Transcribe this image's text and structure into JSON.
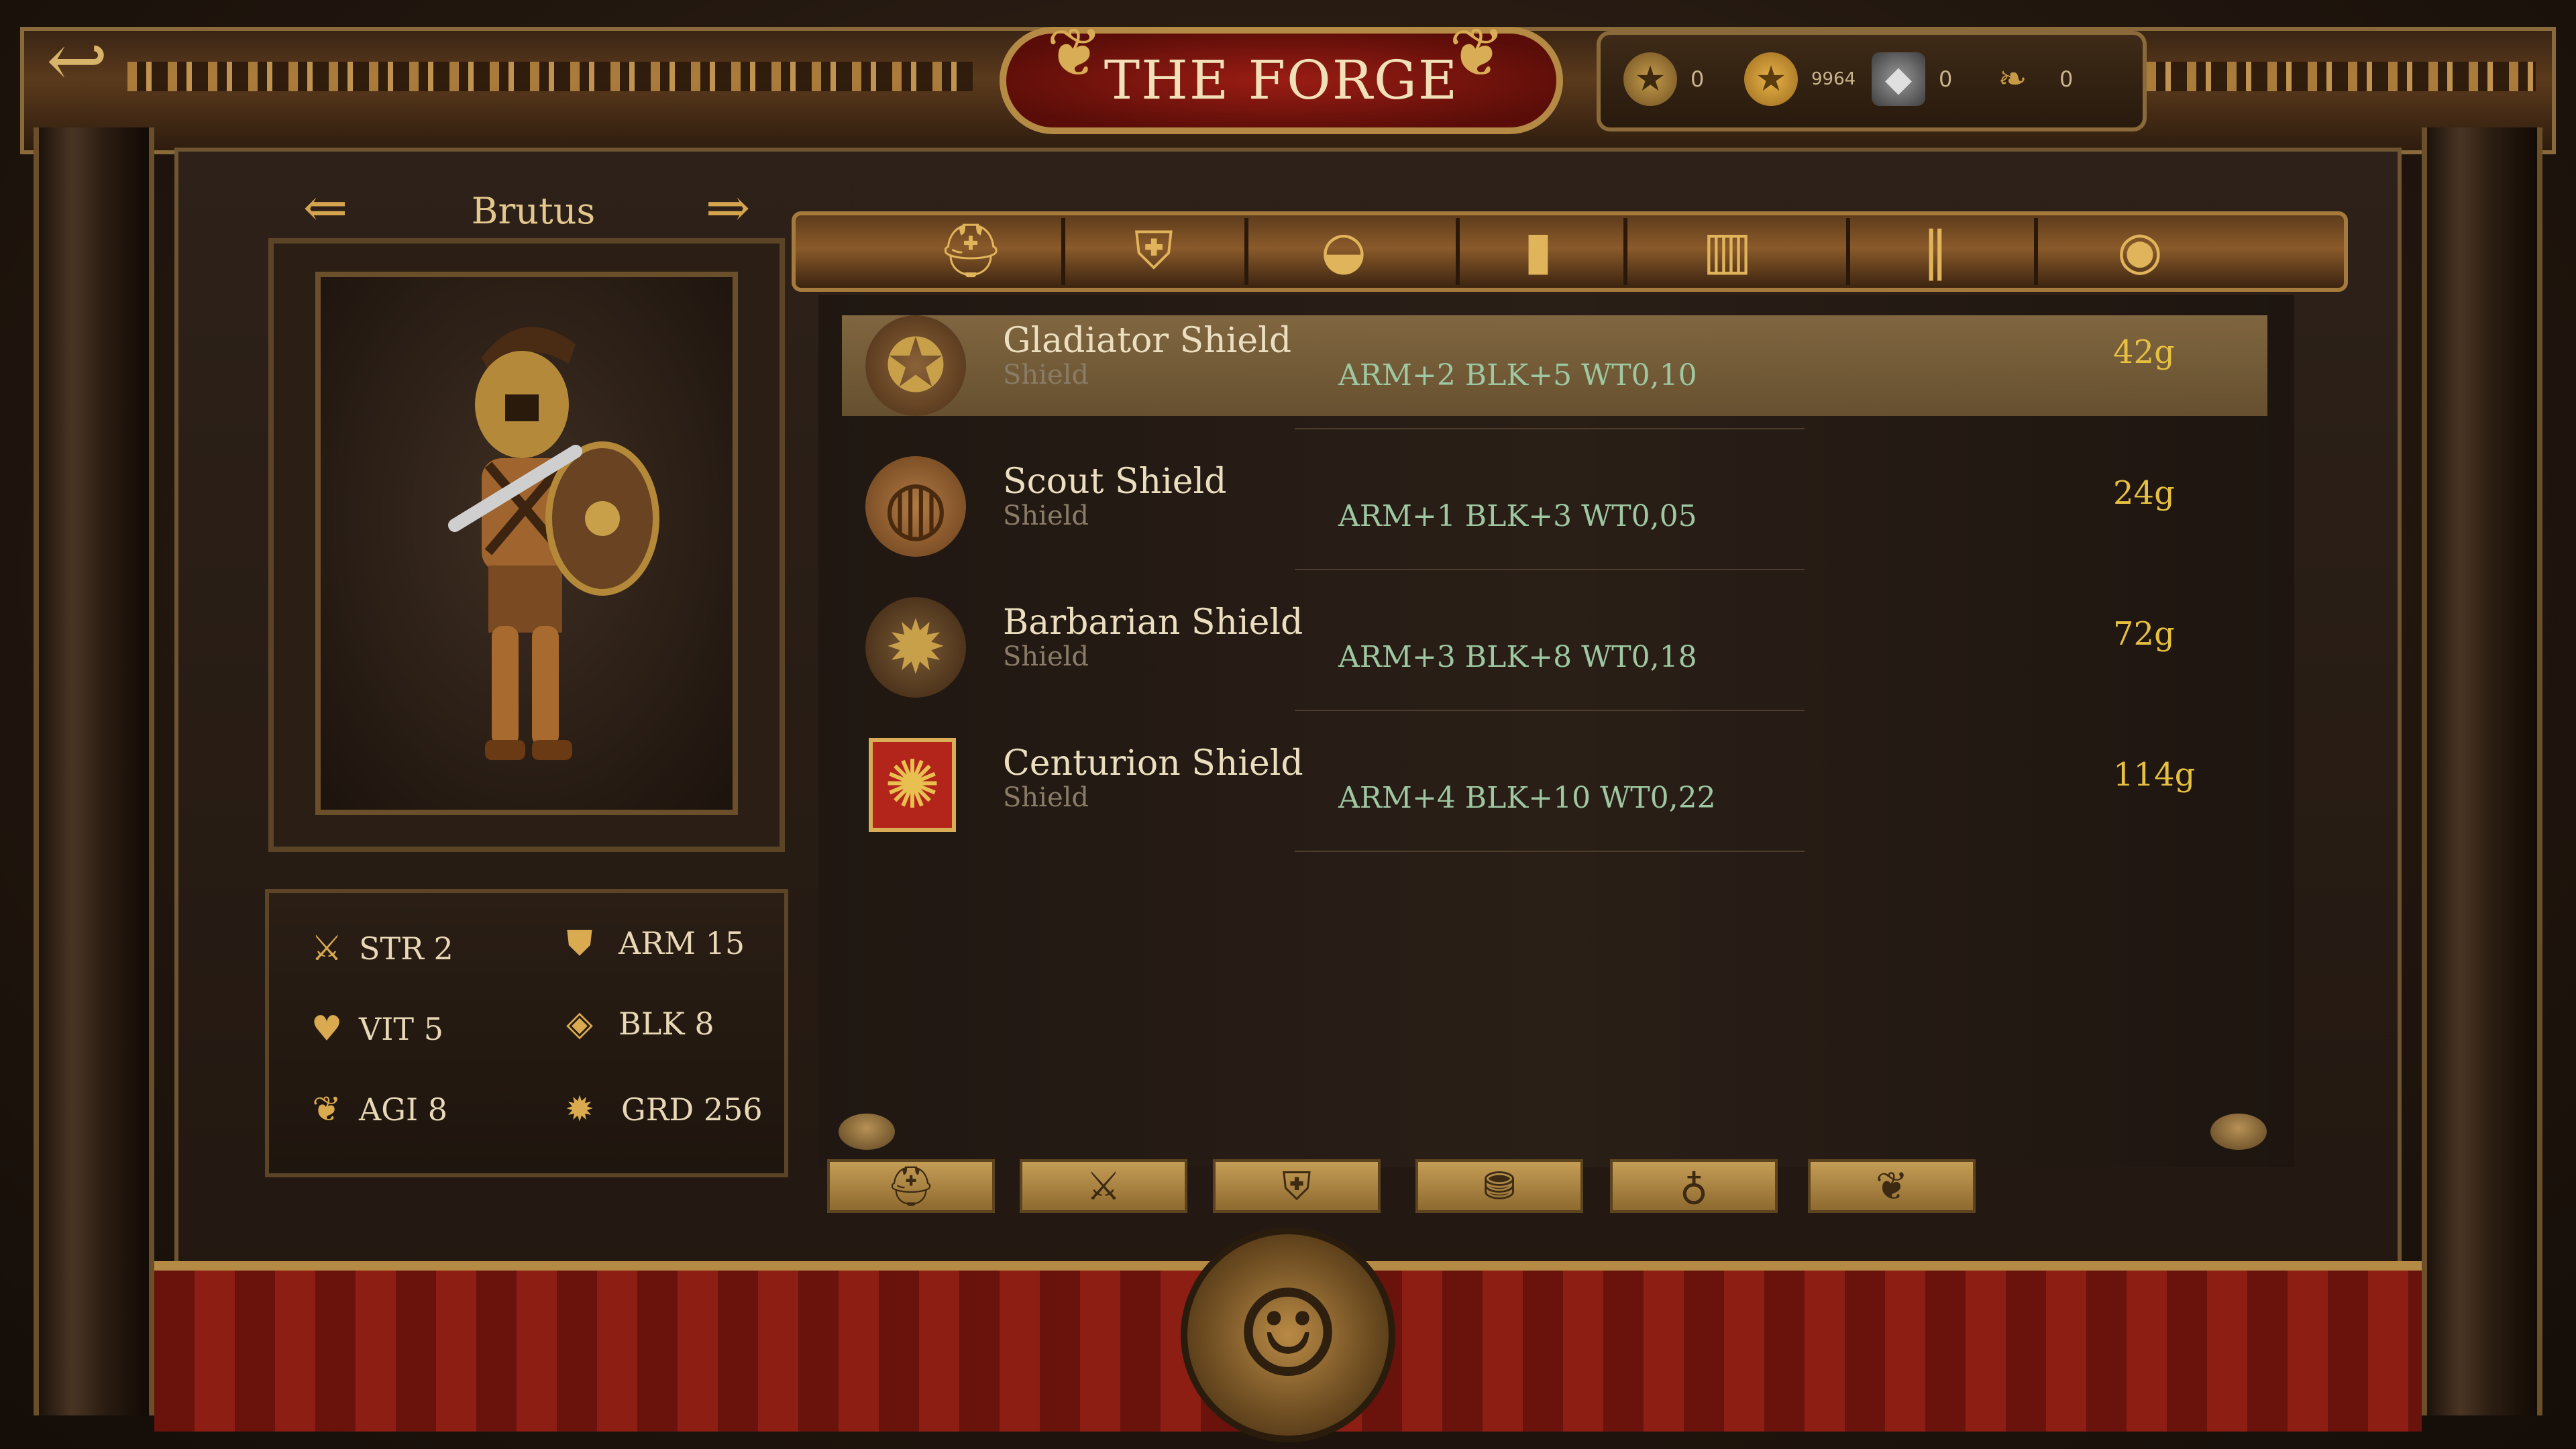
{
  "header": {
    "title": "THE FORGE",
    "back_icon": "back-arrow-icon"
  },
  "currency": [
    {
      "icon": "star-medal-icon",
      "value": "0"
    },
    {
      "icon": "gold-coin-icon",
      "value": "9964"
    },
    {
      "icon": "iron-ingot-icon",
      "value": "0"
    },
    {
      "icon": "laurel-icon",
      "value": "0"
    }
  ],
  "hero": {
    "name": "Brutus"
  },
  "stats": [
    {
      "icon": "crossed-swords-icon",
      "label": "STR 2"
    },
    {
      "icon": "shield-icon",
      "label": "ARM 15"
    },
    {
      "icon": "heart-icon",
      "label": "VIT 5"
    },
    {
      "icon": "block-shield-icon",
      "label": "BLK 8"
    },
    {
      "icon": "wing-icon",
      "label": "AGI 8"
    },
    {
      "icon": "target-icon",
      "label": "GRD 256"
    }
  ],
  "tabs": [
    {
      "icon": "helmet-icon"
    },
    {
      "icon": "chest-armor-icon"
    },
    {
      "icon": "cap-icon"
    },
    {
      "icon": "bracer-icon"
    },
    {
      "icon": "skirt-armor-icon"
    },
    {
      "icon": "greaves-icon"
    },
    {
      "icon": "round-shield-icon"
    }
  ],
  "items": [
    {
      "name": "Gladiator Shield",
      "type": "Shield",
      "stats": "ARM+2 BLK+5 WT0,10",
      "price": "42g",
      "selected": true
    },
    {
      "name": "Scout Shield",
      "type": "Shield",
      "stats": "ARM+1 BLK+3 WT0,05",
      "price": "24g",
      "selected": false
    },
    {
      "name": "Barbarian Shield",
      "type": "Shield",
      "stats": "ARM+3 BLK+8 WT0,18",
      "price": "72g",
      "selected": false
    },
    {
      "name": "Centurion Shield",
      "type": "Shield",
      "stats": "ARM+4 BLK+10 WT0,22",
      "price": "114g",
      "selected": false
    }
  ],
  "bottom_buttons": [
    {
      "icon": "helmet-icon"
    },
    {
      "icon": "crossed-swords-icon"
    },
    {
      "icon": "armor-icon"
    },
    {
      "icon": "coin-stack-icon"
    },
    {
      "icon": "money-bag-icon"
    },
    {
      "icon": "laurel-wreath-icon"
    }
  ],
  "colors": {
    "accent_gold": "#d9ad55",
    "banner_red": "#9a1d14",
    "price_yellow": "#e6c040",
    "stat_green": "#9ec8a2"
  }
}
